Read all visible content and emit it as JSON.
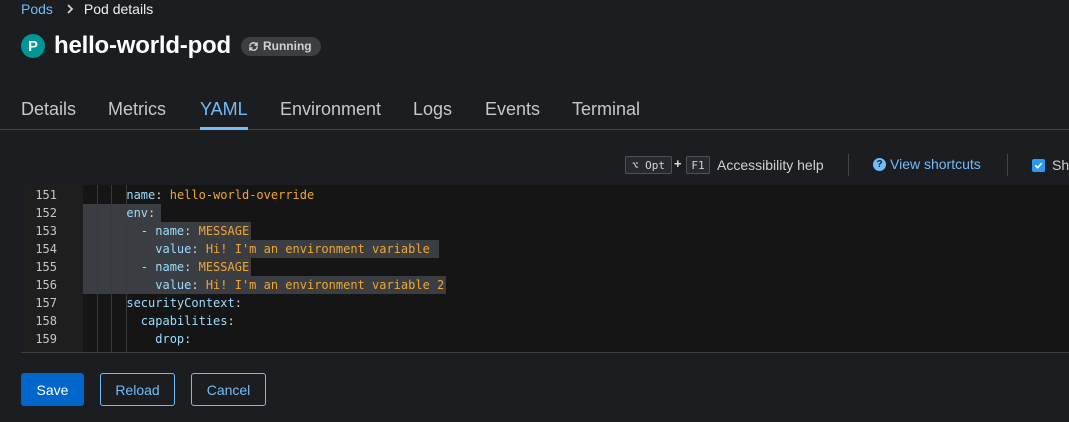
{
  "breadcrumb": {
    "parent": "Pods",
    "current": "Pod details"
  },
  "header": {
    "badge": "P",
    "name": "hello-world-pod",
    "status": "Running"
  },
  "tabs": [
    {
      "label": "Details"
    },
    {
      "label": "Metrics"
    },
    {
      "label": "YAML",
      "active": true
    },
    {
      "label": "Environment"
    },
    {
      "label": "Logs"
    },
    {
      "label": "Events"
    },
    {
      "label": "Terminal"
    }
  ],
  "toolbar": {
    "key1": "⌥ Opt",
    "plus": "+",
    "key2": "F1",
    "accessibility_help": "Accessibility help",
    "view_shortcuts": "View shortcuts",
    "show_label": "Sh",
    "show_checked": true
  },
  "editor": {
    "lines": [
      {
        "num": "151",
        "indent": "      ",
        "key": "name",
        "value": "hello-world-override"
      },
      {
        "num": "152",
        "indent": "      ",
        "key": "env",
        "value": ""
      },
      {
        "num": "153",
        "indent": "        - ",
        "key": "name",
        "value": "MESSAGE"
      },
      {
        "num": "154",
        "indent": "          ",
        "key": "value",
        "value": "Hi! I'm an environment variable"
      },
      {
        "num": "155",
        "indent": "        - ",
        "key": "name",
        "value": "MESSAGE"
      },
      {
        "num": "156",
        "indent": "          ",
        "key": "value",
        "value": "Hi! I'm an environment variable 2"
      },
      {
        "num": "157",
        "indent": "      ",
        "key": "securityContext",
        "value": ""
      },
      {
        "num": "158",
        "indent": "        ",
        "key": "capabilities",
        "value": ""
      },
      {
        "num": "159",
        "indent": "          ",
        "key": "drop",
        "value": ""
      }
    ]
  },
  "actions": {
    "save": "Save",
    "reload": "Reload",
    "cancel": "Cancel"
  },
  "colors": {
    "accent": "#73bcf7",
    "primary_button": "#0066cc",
    "badge": "#009596",
    "string_value": "#f0a732"
  }
}
